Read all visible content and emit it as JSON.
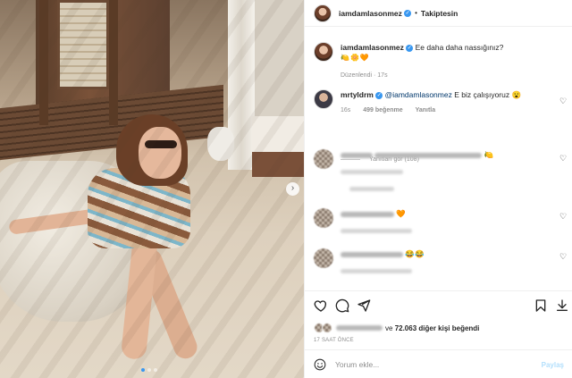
{
  "post": {
    "username": "iamdamlasonmez",
    "follow_label": "Takiptesin",
    "separator": "•"
  },
  "caption": {
    "username": "iamdamlasonmez",
    "text": "Ee daha daha nassığınız?",
    "emojis": "🍋🌼🧡",
    "edited_label": "Düzenlendi",
    "dot": "·",
    "time": "17s"
  },
  "comments": [
    {
      "username": "mrtyldrm",
      "mention": "@iamdamlasonmez",
      "text": "E biz çalışıyoruz",
      "emoji": "😮",
      "time": "16s",
      "likes": "499 beğenme",
      "reply_label": "Yanıtla"
    }
  ],
  "view_replies_label": "Yanıtları gör (108)",
  "blurred_comment_emojis": [
    "🍋",
    "🧡",
    "😂😂"
  ],
  "likes": {
    "prefix": "ve",
    "count": "72.063",
    "suffix": "diğer kişi beğendi"
  },
  "timestamp": "17 SAAT ÖNCE",
  "add_comment": {
    "placeholder": "Yorum ekle...",
    "post_label": "Paylaş"
  },
  "icons": [
    "heart-icon",
    "comment-icon",
    "share-icon",
    "bookmark-icon",
    "download-icon",
    "emoji-icon",
    "chevron-right-icon",
    "verified-badge-icon"
  ],
  "colors": {
    "link_blue": "#3897f0",
    "post_disabled": "#b2dffc",
    "mention": "#00376b"
  }
}
